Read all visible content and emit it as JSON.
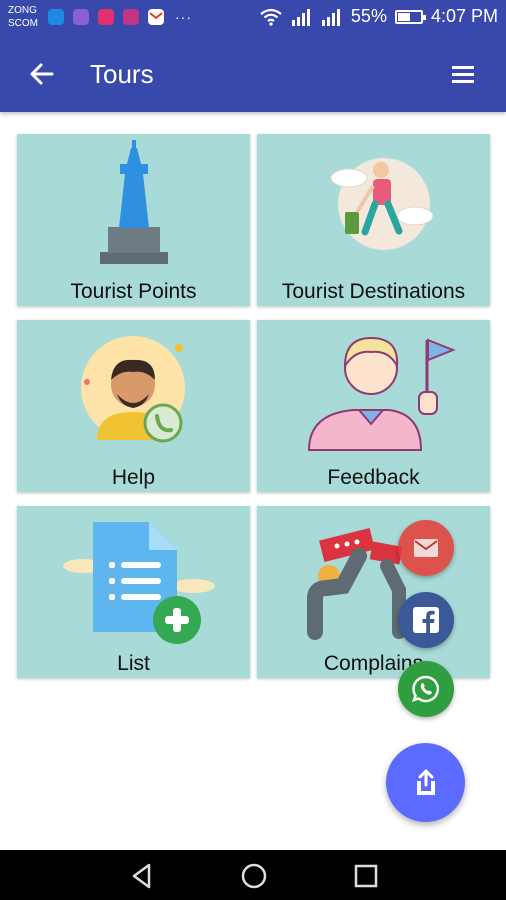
{
  "status_bar": {
    "carrier_line1": "ZONG",
    "carrier_line2": "SCOM",
    "notification_icons": [
      "messenger-icon",
      "gallery-icon",
      "instagram-icon",
      "instagram-icon",
      "gmail-icon"
    ],
    "more": "···",
    "battery_percent": "55%",
    "battery_level": 0.55,
    "time": "4:07 PM"
  },
  "app_bar": {
    "back_icon": "arrow-back-icon",
    "title": "Tours",
    "menu_icon": "hamburger-menu-icon",
    "color": "#3949ab"
  },
  "tiles": [
    {
      "label": "Tourist Points",
      "icon": "monument-icon"
    },
    {
      "label": "Tourist Destinations",
      "icon": "traveler-icon"
    },
    {
      "label": "Help",
      "icon": "support-person-icon"
    },
    {
      "label": "Feedback",
      "icon": "guide-with-flag-icon"
    },
    {
      "label": "List",
      "icon": "document-add-icon"
    },
    {
      "label": "Complains",
      "icon": "protest-signs-icon"
    }
  ],
  "tile_color": "#a8dad7",
  "fabs": {
    "email_icon": "email-icon",
    "facebook_icon": "facebook-icon",
    "whatsapp_icon": "whatsapp-icon",
    "share_icon": "share-icon",
    "main_color": "#5c6bff"
  },
  "nav_bar": {
    "back_icon": "nav-back-icon",
    "home_icon": "nav-home-icon",
    "recents_icon": "nav-recents-icon"
  }
}
